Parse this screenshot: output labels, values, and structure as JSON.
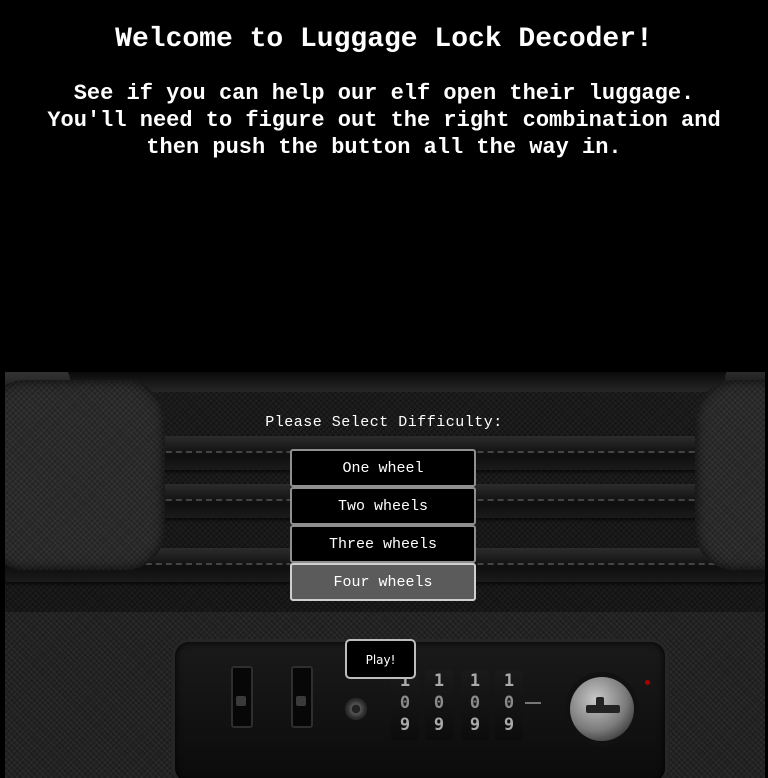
{
  "header": {
    "title": "Welcome to Luggage Lock Decoder!",
    "intro_lines": [
      "See if you can help our elf open their luggage.",
      "You'll need to figure out the right combination and",
      "then push the button all the way in."
    ]
  },
  "difficulty": {
    "label": "Please Select Difficulty:",
    "options": [
      {
        "label": "One wheel",
        "selected": false
      },
      {
        "label": "Two wheels",
        "selected": false
      },
      {
        "label": "Three wheels",
        "selected": false
      },
      {
        "label": "Four wheels",
        "selected": true
      }
    ]
  },
  "play_button": {
    "label": "Play!"
  },
  "lock": {
    "wheels": [
      {
        "digits": [
          "1",
          "0",
          "9"
        ]
      },
      {
        "digits": [
          "1",
          "0",
          "9"
        ]
      },
      {
        "digits": [
          "1",
          "0",
          "9"
        ]
      },
      {
        "digits": [
          "1",
          "0",
          "9"
        ]
      }
    ]
  },
  "colors": {
    "background": "#000000",
    "text": "#ffffff",
    "selected_button": "#5b5b5b"
  }
}
